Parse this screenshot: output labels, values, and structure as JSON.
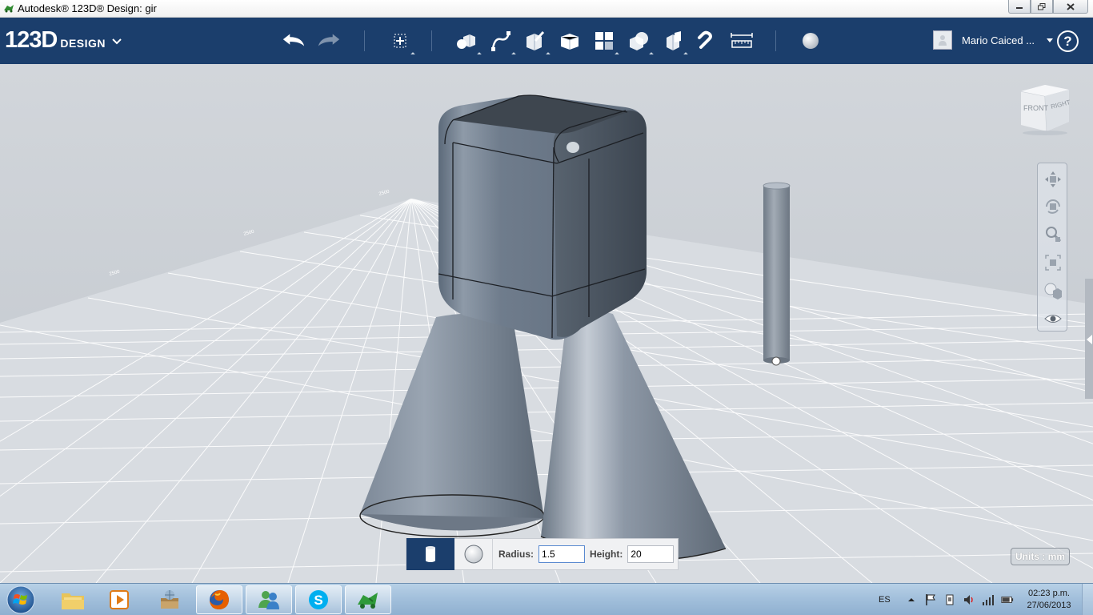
{
  "window": {
    "title": "Autodesk® 123D® Design: gir",
    "minimize_icon": "minimize-icon",
    "maximize_icon": "restore-icon",
    "close_icon": "close-icon"
  },
  "toolbar": {
    "logo_number": "123D",
    "logo_word": "DESIGN",
    "tools": [
      "undo",
      "redo",
      "transform",
      "primitives",
      "sketch",
      "construct",
      "modify",
      "pattern",
      "grouping",
      "combine",
      "snap",
      "measure",
      "material"
    ],
    "user_name": "Mario Caiced ...",
    "help_label": "?"
  },
  "viewport": {
    "viewcube": {
      "front_label": "FRONT",
      "right_label": "RIGHT"
    },
    "nav_tools": [
      "pan-icon",
      "orbit-icon",
      "zoom-icon",
      "fit-icon",
      "view-icon",
      "eye-icon"
    ],
    "units_label": "Units : mm",
    "grid_labels": [
      "2500",
      "2500",
      "2500"
    ]
  },
  "primitive_panel": {
    "shape": "cylinder",
    "radius_label": "Radius:",
    "radius_value": "1.5",
    "height_label": "Height:",
    "height_value": "20"
  },
  "taskbar": {
    "apps": [
      "explorer",
      "media-player",
      "archive",
      "firefox",
      "messenger",
      "skype",
      "123d-design"
    ],
    "language": "ES",
    "time": "02:23 p.m.",
    "date": "27/06/2013"
  }
}
